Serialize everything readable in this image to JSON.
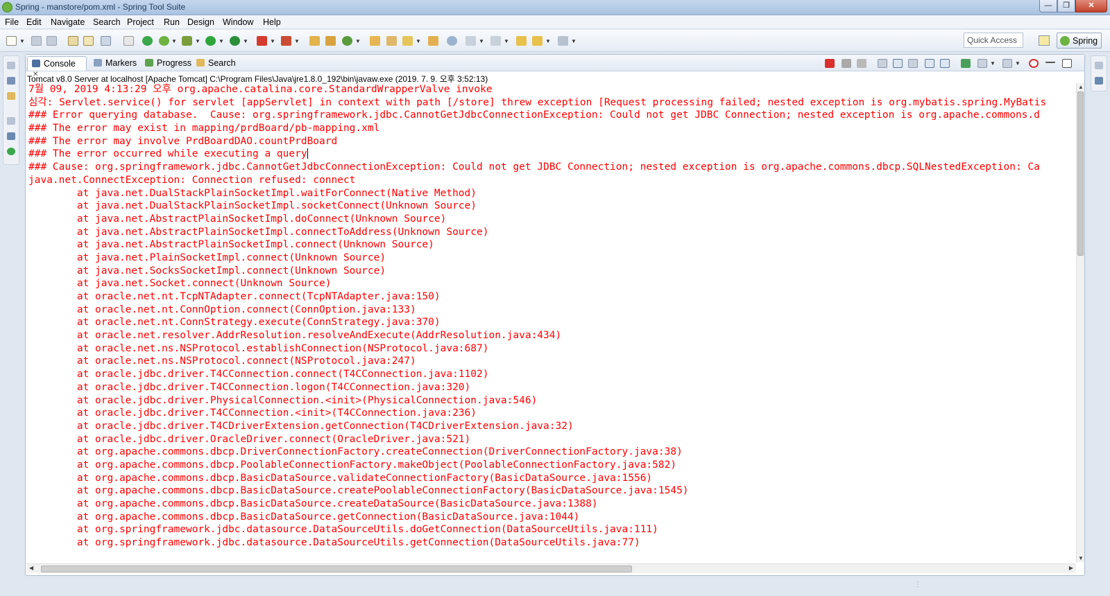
{
  "window": {
    "title": "Spring - manstore/pom.xml - Spring Tool Suite",
    "minimize_glyph": "—",
    "maximize_glyph": "❐",
    "close_glyph": "✕"
  },
  "menu": [
    "File",
    "Edit",
    "Navigate",
    "Search",
    "Project",
    "Run",
    "Design",
    "Window",
    "Help"
  ],
  "toolbar": {
    "quick_access_placeholder": "Quick Access",
    "perspective_label": "Spring"
  },
  "tabs": [
    {
      "label": "Console",
      "active": true,
      "close": "✕"
    },
    {
      "label": "Markers"
    },
    {
      "label": "Progress"
    },
    {
      "label": "Search"
    }
  ],
  "console": {
    "process_label": "Tomcat v8.0 Server at localhost [Apache Tomcat] C:\\Program Files\\Java\\jre1.8.0_192\\bin\\javaw.exe (2019. 7. 9. 오후 3:52:13)",
    "lines": [
      "7월 09, 2019 4:13:29 오후 org.apache.catalina.core.StandardWrapperValve invoke",
      "심각: Servlet.service() for servlet [appServlet] in context with path [/store] threw exception [Request processing failed; nested exception is org.mybatis.spring.MyBatis",
      "### Error querying database.  Cause: org.springframework.jdbc.CannotGetJdbcConnectionException: Could not get JDBC Connection; nested exception is org.apache.commons.d",
      "### The error may exist in mapping/prdBoard/pb-mapping.xml",
      "### The error may involve PrdBoardDAO.countPrdBoard",
      "### The error occurred while executing a query",
      "### Cause: org.springframework.jdbc.CannotGetJdbcConnectionException: Could not get JDBC Connection; nested exception is org.apache.commons.dbcp.SQLNestedException: Ca",
      "java.net.ConnectException: Connection refused: connect",
      "\tat java.net.DualStackPlainSocketImpl.waitForConnect(Native Method)",
      "\tat java.net.DualStackPlainSocketImpl.socketConnect(Unknown Source)",
      "\tat java.net.AbstractPlainSocketImpl.doConnect(Unknown Source)",
      "\tat java.net.AbstractPlainSocketImpl.connectToAddress(Unknown Source)",
      "\tat java.net.AbstractPlainSocketImpl.connect(Unknown Source)",
      "\tat java.net.PlainSocketImpl.connect(Unknown Source)",
      "\tat java.net.SocksSocketImpl.connect(Unknown Source)",
      "\tat java.net.Socket.connect(Unknown Source)",
      "\tat oracle.net.nt.TcpNTAdapter.connect(TcpNTAdapter.java:150)",
      "\tat oracle.net.nt.ConnOption.connect(ConnOption.java:133)",
      "\tat oracle.net.nt.ConnStrategy.execute(ConnStrategy.java:370)",
      "\tat oracle.net.resolver.AddrResolution.resolveAndExecute(AddrResolution.java:434)",
      "\tat oracle.net.ns.NSProtocol.establishConnection(NSProtocol.java:687)",
      "\tat oracle.net.ns.NSProtocol.connect(NSProtocol.java:247)",
      "\tat oracle.jdbc.driver.T4CConnection.connect(T4CConnection.java:1102)",
      "\tat oracle.jdbc.driver.T4CConnection.logon(T4CConnection.java:320)",
      "\tat oracle.jdbc.driver.PhysicalConnection.<init>(PhysicalConnection.java:546)",
      "\tat oracle.jdbc.driver.T4CConnection.<init>(T4CConnection.java:236)",
      "\tat oracle.jdbc.driver.T4CDriverExtension.getConnection(T4CDriverExtension.java:32)",
      "\tat oracle.jdbc.driver.OracleDriver.connect(OracleDriver.java:521)",
      "\tat org.apache.commons.dbcp.DriverConnectionFactory.createConnection(DriverConnectionFactory.java:38)",
      "\tat org.apache.commons.dbcp.PoolableConnectionFactory.makeObject(PoolableConnectionFactory.java:582)",
      "\tat org.apache.commons.dbcp.BasicDataSource.validateConnectionFactory(BasicDataSource.java:1556)",
      "\tat org.apache.commons.dbcp.BasicDataSource.createPoolableConnectionFactory(BasicDataSource.java:1545)",
      "\tat org.apache.commons.dbcp.BasicDataSource.createDataSource(BasicDataSource.java:1388)",
      "\tat org.apache.commons.dbcp.BasicDataSource.getConnection(BasicDataSource.java:1044)",
      "\tat org.springframework.jdbc.datasource.DataSourceUtils.doGetConnection(DataSourceUtils.java:111)",
      "\tat org.springframework.jdbc.datasource.DataSourceUtils.getConnection(DataSourceUtils.java:77)"
    ],
    "error_color": "#ff0000"
  },
  "icons": {
    "toolbar": [
      "new-icon",
      "save-icon",
      "save-all-icon",
      "print-icon",
      "skip-breakpoints-icon",
      "server-start-icon",
      "spring-boot-icon",
      "debug-icon",
      "run-icon",
      "coverage-icon",
      "stop-icon",
      "external-tools-icon",
      "new-package-icon",
      "new-class-icon",
      "refresh-icon",
      "open-type-icon",
      "open-task-icon",
      "search-icon",
      "open-folder-icon",
      "globe-icon",
      "next-annotation-icon",
      "prev-annotation-icon",
      "last-edit-icon",
      "back-icon",
      "forward-icon"
    ],
    "view_toolbar": [
      "terminate-icon",
      "remove-launch-icon",
      "remove-all-icon",
      "clear-console-icon",
      "scroll-lock-icon",
      "word-wrap-icon",
      "show-on-stdout-icon",
      "show-on-stderr-icon",
      "pin-console-icon",
      "display-console-icon",
      "open-console-icon",
      "spring-tools-icon",
      "minimize-icon",
      "maximize-icon"
    ]
  },
  "scrollbars": {
    "v_up": "▲",
    "v_down": "▼",
    "h_left": "◀",
    "h_right": "▶"
  },
  "status": {
    "grip": "⋮"
  }
}
